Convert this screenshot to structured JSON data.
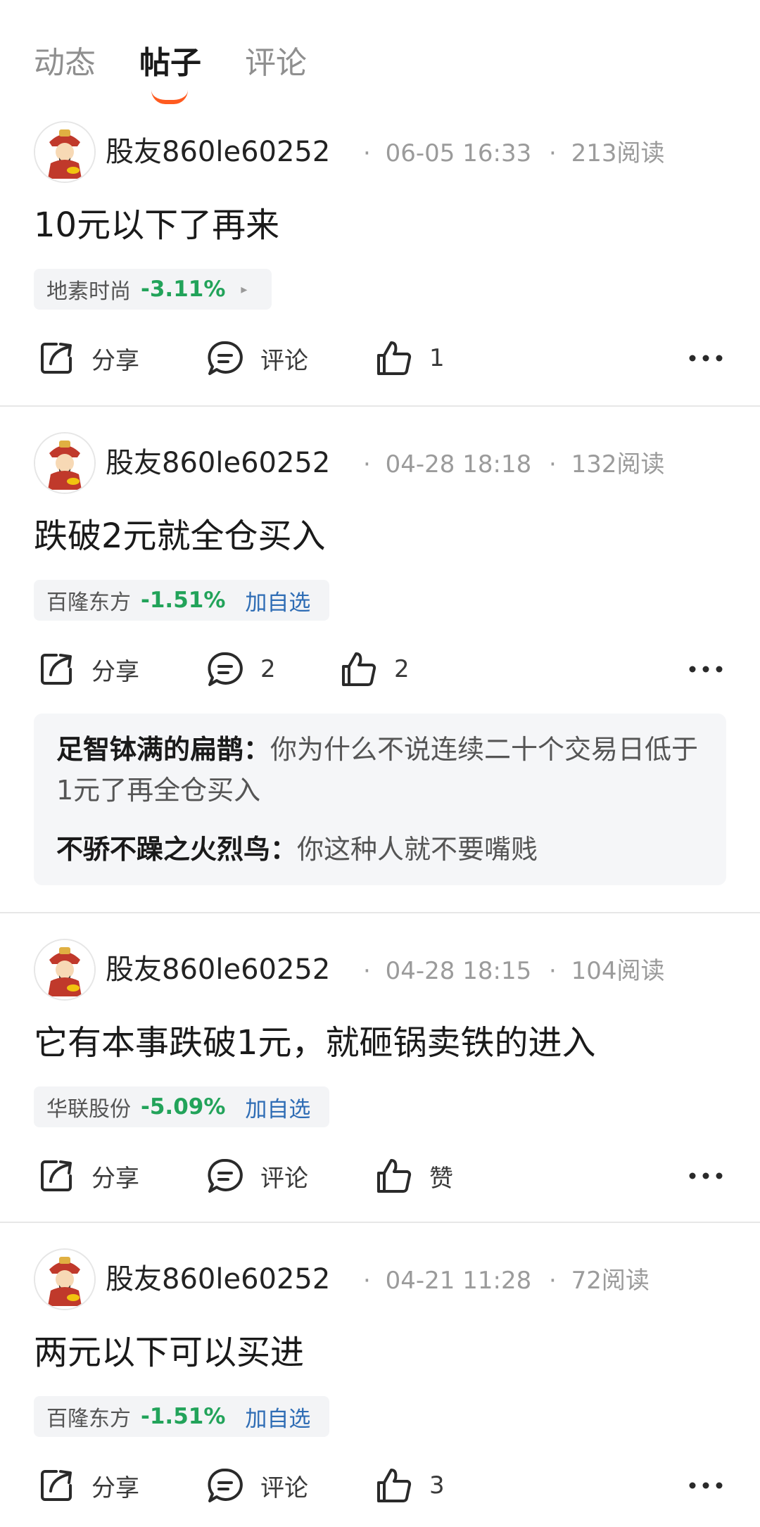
{
  "tabs": [
    {
      "label": "动态",
      "active": false
    },
    {
      "label": "帖子",
      "active": true
    },
    {
      "label": "评论",
      "active": false
    }
  ],
  "colors": {
    "accent": "#ff5a1f",
    "down": "#22a35a",
    "link": "#2f6db5"
  },
  "posts": [
    {
      "user": "股友860le60252",
      "date": "06-05 16:33",
      "reads": "213阅读",
      "text": "10元以下了再来",
      "stock": {
        "name": "地素时尚",
        "change": "-3.11%",
        "extra": "▸"
      },
      "actions": {
        "share": "分享",
        "comment": "评论",
        "like": "1"
      }
    },
    {
      "user": "股友860le60252",
      "date": "04-28 18:18",
      "reads": "132阅读",
      "text": "跌破2元就全仓买入",
      "stock": {
        "name": "百隆东方",
        "change": "-1.51%",
        "extra": "加自选"
      },
      "actions": {
        "share": "分享",
        "comment": "2",
        "like": "2"
      },
      "comments": [
        {
          "author": "足智钵满的扁鹊：",
          "text": "你为什么不说连续二十个交易日低于1元了再全仓买入"
        },
        {
          "author": "不骄不躁之火烈鸟：",
          "text": "你这种人就不要嘴贱"
        }
      ]
    },
    {
      "user": "股友860le60252",
      "date": "04-28 18:15",
      "reads": "104阅读",
      "text": "它有本事跌破1元，就砸锅卖铁的进入",
      "stock": {
        "name": "华联股份",
        "change": "-5.09%",
        "extra": "加自选"
      },
      "actions": {
        "share": "分享",
        "comment": "评论",
        "like": "赞"
      }
    },
    {
      "user": "股友860le60252",
      "date": "04-21 11:28",
      "reads": "72阅读",
      "text": "两元以下可以买进",
      "stock": {
        "name": "百隆东方",
        "change": "-1.51%",
        "extra": "加自选"
      },
      "actions": {
        "share": "分享",
        "comment": "评论",
        "like": "3"
      }
    }
  ],
  "meta_separator": "·",
  "icons": [
    "share-icon",
    "comment-icon",
    "like-icon",
    "more-icon",
    "avatar-caishen"
  ]
}
